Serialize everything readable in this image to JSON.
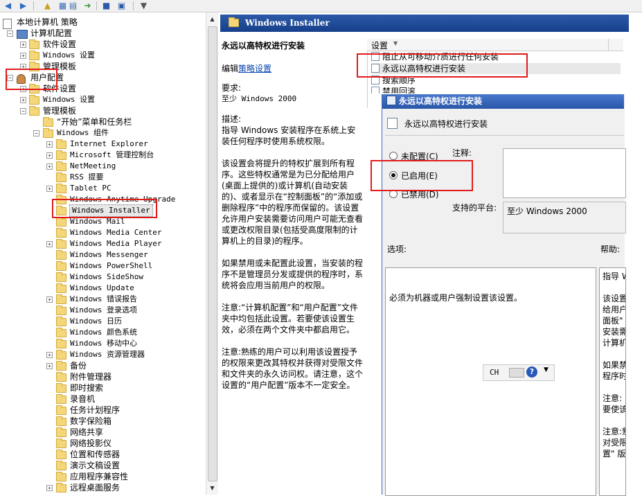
{
  "toolbar": {
    "icons": [
      "back-icon",
      "forward-icon",
      "up-icon",
      "show-hide-tree-icon",
      "properties-icon",
      "export-list-icon",
      "help-icon",
      "filter-icon"
    ]
  },
  "tree": {
    "items": [
      {
        "label": "本地计算机 策略",
        "indent": 0,
        "exp": "",
        "icon": "policy"
      },
      {
        "label": "计算机配置",
        "indent": 1,
        "exp": "-",
        "icon": "computer"
      },
      {
        "label": "软件设置",
        "indent": 2,
        "exp": "+",
        "icon": "folder"
      },
      {
        "label": "Windows 设置",
        "indent": 2,
        "exp": "+",
        "icon": "folder",
        "mono": true
      },
      {
        "label": "管理模板",
        "indent": 2,
        "exp": "+",
        "icon": "folder"
      },
      {
        "label": "用户配置",
        "indent": 1,
        "exp": "-",
        "icon": "user"
      },
      {
        "label": "软件设置",
        "indent": 2,
        "exp": "+",
        "icon": "folder"
      },
      {
        "label": "Windows 设置",
        "indent": 2,
        "exp": "+",
        "icon": "folder",
        "mono": true
      },
      {
        "label": "管理模板",
        "indent": 2,
        "exp": "-",
        "icon": "folder"
      },
      {
        "label": "“开始”菜单和任务栏",
        "indent": 3,
        "exp": "",
        "icon": "folder"
      },
      {
        "label": "Windows 组件",
        "indent": 3,
        "exp": "-",
        "icon": "folder",
        "mono": true
      },
      {
        "label": "Internet Explorer",
        "indent": 4,
        "exp": "+",
        "icon": "folder",
        "mono": true
      },
      {
        "label": "Microsoft 管理控制台",
        "indent": 4,
        "exp": "+",
        "icon": "folder",
        "mono": true
      },
      {
        "label": "NetMeeting",
        "indent": 4,
        "exp": "+",
        "icon": "folder",
        "mono": true
      },
      {
        "label": "RSS 提要",
        "indent": 4,
        "exp": "",
        "icon": "folder",
        "mono": true
      },
      {
        "label": "Tablet PC",
        "indent": 4,
        "exp": "+",
        "icon": "folder",
        "mono": true
      },
      {
        "label": "Windows Anytime Upgrade",
        "indent": 4,
        "exp": "",
        "icon": "folder",
        "mono": true
      },
      {
        "label": "Windows Installer",
        "indent": 4,
        "exp": "",
        "icon": "folder",
        "mono": true,
        "selected": true
      },
      {
        "label": "Windows Mail",
        "indent": 4,
        "exp": "",
        "icon": "folder",
        "mono": true
      },
      {
        "label": "Windows Media Center",
        "indent": 4,
        "exp": "",
        "icon": "folder",
        "mono": true
      },
      {
        "label": "Windows Media Player",
        "indent": 4,
        "exp": "+",
        "icon": "folder",
        "mono": true
      },
      {
        "label": "Windows Messenger",
        "indent": 4,
        "exp": "",
        "icon": "folder",
        "mono": true
      },
      {
        "label": "Windows PowerShell",
        "indent": 4,
        "exp": "",
        "icon": "folder",
        "mono": true
      },
      {
        "label": "Windows SideShow",
        "indent": 4,
        "exp": "",
        "icon": "folder",
        "mono": true
      },
      {
        "label": "Windows Update",
        "indent": 4,
        "exp": "",
        "icon": "folder",
        "mono": true
      },
      {
        "label": "Windows 错误报告",
        "indent": 4,
        "exp": "+",
        "icon": "folder",
        "mono": true
      },
      {
        "label": "Windows 登录选项",
        "indent": 4,
        "exp": "",
        "icon": "folder",
        "mono": true
      },
      {
        "label": "Windows 日历",
        "indent": 4,
        "exp": "",
        "icon": "folder",
        "mono": true
      },
      {
        "label": "Windows 颜色系统",
        "indent": 4,
        "exp": "",
        "icon": "folder",
        "mono": true
      },
      {
        "label": "Windows 移动中心",
        "indent": 4,
        "exp": "",
        "icon": "folder",
        "mono": true
      },
      {
        "label": "Windows 资源管理器",
        "indent": 4,
        "exp": "+",
        "icon": "folder",
        "mono": true
      },
      {
        "label": "备份",
        "indent": 4,
        "exp": "+",
        "icon": "folder"
      },
      {
        "label": "附件管理器",
        "indent": 4,
        "exp": "",
        "icon": "folder"
      },
      {
        "label": "即时搜索",
        "indent": 4,
        "exp": "",
        "icon": "folder"
      },
      {
        "label": "录音机",
        "indent": 4,
        "exp": "",
        "icon": "folder"
      },
      {
        "label": "任务计划程序",
        "indent": 4,
        "exp": "",
        "icon": "folder"
      },
      {
        "label": "数字保险箱",
        "indent": 4,
        "exp": "",
        "icon": "folder"
      },
      {
        "label": "网络共享",
        "indent": 4,
        "exp": "",
        "icon": "folder"
      },
      {
        "label": "网络投影仪",
        "indent": 4,
        "exp": "",
        "icon": "folder"
      },
      {
        "label": "位置和传感器",
        "indent": 4,
        "exp": "",
        "icon": "folder"
      },
      {
        "label": "演示文稿设置",
        "indent": 4,
        "exp": "",
        "icon": "folder"
      },
      {
        "label": "应用程序兼容性",
        "indent": 4,
        "exp": "",
        "icon": "folder"
      },
      {
        "label": "远程桌面服务",
        "indent": 4,
        "exp": "+",
        "icon": "folder"
      }
    ]
  },
  "header": {
    "title": "Windows Installer"
  },
  "description": {
    "title": "永远以高特权进行安装",
    "edit_prefix": "编辑",
    "edit_link": "策略设置",
    "requirements_label": "要求:",
    "requirements_value": "至少 Windows 2000",
    "desc_label": "描述:",
    "desc_text": "指导 Windows 安装程序在系统上安装任何程序时使用系统权限。",
    "para1": "该设置会将提升的特权扩展到所有程序。这些特权通常是为已分配给用户(桌面上提供的)或计算机(自动安装的)、或者显示在“控制面板”的“添加或删除程序”中的程序而保留的。该设置允许用户安装需要访问用户可能无查看或更改权限目录(包括受高度限制的计算机上的目录)的程序。",
    "para2": "如果禁用或未配置此设置，当安装的程序不是管理员分发或提供的程序时，系统将会应用当前用户的权限。",
    "para3": "注意:“计算机配置”和“用户配置”文件夹中均包括此设置。若要使该设置生效，必须在两个文件夹中都启用它。",
    "para4": "注意:熟练的用户可以利用该设置授予的权限来更改其特权并获得对受限文件和文件夹的永久访问权。请注意，这个设置的“用户配置”版本不一定安全。"
  },
  "list": {
    "column_header": "设置",
    "rows": [
      "阻止从可移动介质进行任何安装",
      "永远以高特权进行安装",
      "搜索顺序",
      "禁用回滚"
    ]
  },
  "dialog": {
    "title": "永远以高特权进行安装",
    "subtitle": "永远以高特权进行安装",
    "radio_not_configured": "未配置(C)",
    "radio_enabled": "已启用(E)",
    "radio_disabled": "已禁用(D)",
    "selected": "enabled",
    "comment_label": "注释:",
    "platform_label": "支持的平台:",
    "platform_value": "至少 Windows 2000",
    "options_label": "选项:",
    "help_label": "帮助:",
    "options_text": "必须为机器或用户强制设置该设置。",
    "help_lines": [
      "指导 W",
      "该设置",
      "给用户",
      "面板\"",
      "安装需",
      "计算机",
      "如果禁",
      "程序时",
      "注意:",
      "要使该",
      "注意:熟",
      "对受限",
      "置\" 版"
    ]
  },
  "ime": {
    "lang": "CH"
  }
}
